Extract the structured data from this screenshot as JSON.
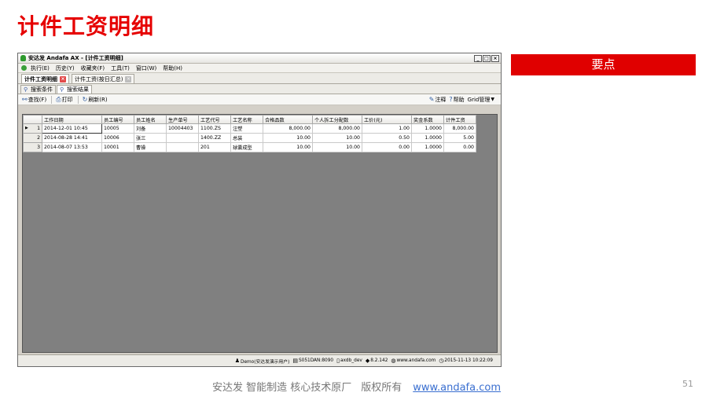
{
  "slide": {
    "title": "计件工资明细",
    "keypoint": "要点",
    "footer_text": "安达发   智能制造 核心技术原厂",
    "footer_rights": "版权所有",
    "footer_link": "www.andafa.com",
    "page_number": "51"
  },
  "window": {
    "title": "安达发 Andafa AX - [计件工资明细]",
    "controls": [
      "_",
      "□",
      "×"
    ],
    "menu": [
      "执行(E)",
      "历史(Y)",
      "收藏夹(F)",
      "工具(T)",
      "窗口(W)",
      "帮助(H)"
    ],
    "doc_tabs": [
      {
        "label": "计件工资明细",
        "active": true
      },
      {
        "label": "计件工资(按日汇总)",
        "active": false
      }
    ],
    "sub_tabs": [
      {
        "label": "搜索条件",
        "active": false
      },
      {
        "label": "搜索结果",
        "active": true
      }
    ],
    "toolbar": {
      "search": "查找(F)",
      "print": "打印",
      "refresh": "刷新(R)",
      "comment": "注释",
      "help": "帮助",
      "grid_manage": "Grid管理"
    },
    "grid": {
      "columns": [
        "工作日期",
        "员工编号",
        "员工姓名",
        "生产单号",
        "工艺代号",
        "工艺名称",
        "合格品数",
        "个人拆工分配数",
        "工价(元)",
        "奖金系数",
        "计件工资"
      ],
      "rows": [
        {
          "no": "1",
          "current": true,
          "cells": [
            "2014-12-01 10:45",
            "10005",
            "刘备",
            "10004403",
            "1100.ZS",
            "注塑",
            "8,000.00",
            "8,000.00",
            "1.00",
            "1.0000",
            "8,000.00"
          ]
        },
        {
          "no": "2",
          "current": false,
          "cells": [
            "2014-08-28 14:41",
            "10006",
            "张三",
            "",
            "1400.ZZ",
            "总装",
            "10.00",
            "10.00",
            "0.50",
            "1.0000",
            "5.00"
          ]
        },
        {
          "no": "3",
          "current": false,
          "cells": [
            "2014-08-07 13:53",
            "10001",
            "曹操",
            "",
            "201",
            "球囊成型",
            "10.00",
            "10.00",
            "0.00",
            "1.0000",
            "0.00"
          ]
        }
      ]
    },
    "status": {
      "user": "Demo(安达发演示用户)",
      "server": "S051DAN:8090",
      "db": "axdb_dev",
      "version": "8.2.142",
      "site": "www.andafa.com",
      "datetime": "2015-11-13 10:22:09"
    }
  }
}
